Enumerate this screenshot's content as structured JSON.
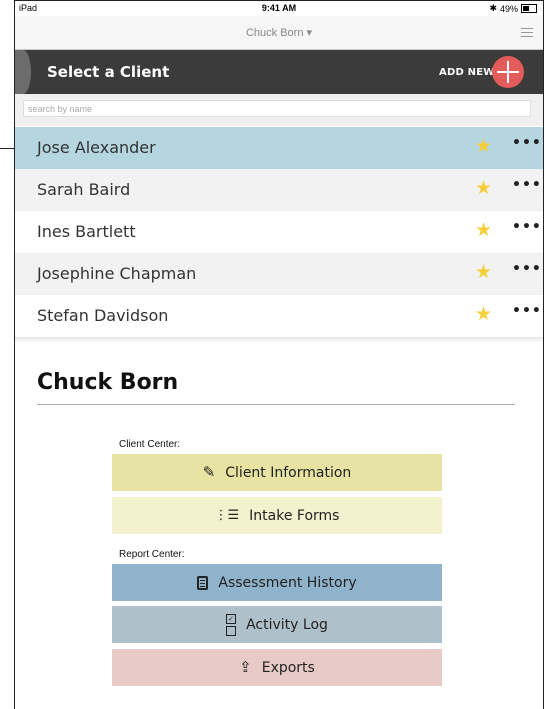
{
  "status_bar": {
    "device": "iPad",
    "wifi_icon": "wifi-icon",
    "time": "9:41 AM",
    "bluetooth_icon": "bluetooth-icon",
    "battery": "49%",
    "battery_level": 0.49
  },
  "nav": {
    "title": "Chuck Born ▾",
    "menu_icon": "hamburger-menu-icon"
  },
  "header": {
    "title": "Select a Client",
    "add_new_label": "ADD NEW",
    "add_icon": "plus-icon",
    "accent_color": "#e35b5b"
  },
  "search": {
    "placeholder": "search by name",
    "value": ""
  },
  "clients": [
    {
      "name": "Jose Alexander",
      "favorite": true,
      "selected": true
    },
    {
      "name": "Sarah Baird",
      "favorite": true,
      "selected": false
    },
    {
      "name": "Ines Bartlett",
      "favorite": true,
      "selected": false
    },
    {
      "name": "Josephine Chapman",
      "favorite": true,
      "selected": false
    },
    {
      "name": "Stefan Davidson",
      "favorite": true,
      "selected": false
    }
  ],
  "profile": {
    "title": "Chuck Born",
    "client_center_label": "Client Center:",
    "report_center_label": "Report Center:",
    "buttons": {
      "client_information": "Client Information",
      "intake_forms": "Intake Forms",
      "assessment_history": "Assessment History",
      "activity_log": "Activity Log",
      "exports": "Exports"
    },
    "colors": {
      "client_information": "#e6e3a3",
      "intake_forms": "#f4f1ce",
      "assessment_history": "#8fb3ca",
      "activity_log": "#aec0c9",
      "exports": "#e8cac6"
    }
  }
}
